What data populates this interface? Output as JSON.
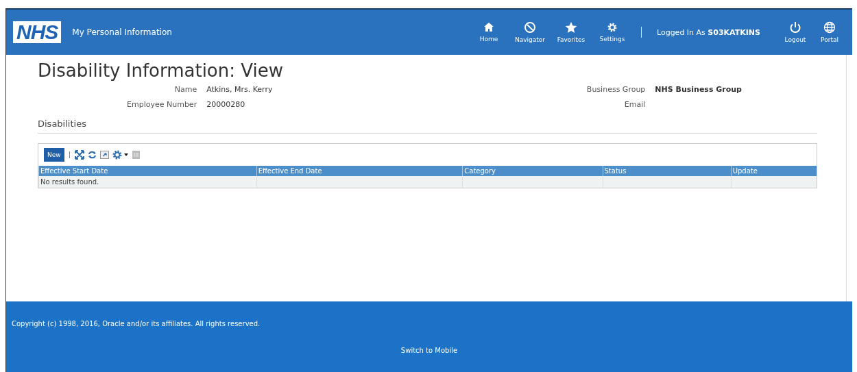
{
  "header": {
    "logo": "NHS",
    "app_title": "My Personal Information",
    "nav": [
      {
        "kind": "home",
        "label": "Home"
      },
      {
        "kind": "navigator",
        "label": "Navigator"
      },
      {
        "kind": "favorites",
        "label": "Favorites"
      },
      {
        "kind": "settings",
        "label": "Settings"
      }
    ],
    "logged_in": "Logged In As **S03KATKINS**",
    "actions": [
      {
        "kind": "logout",
        "label": "Logout"
      },
      {
        "kind": "portal",
        "label": "Portal"
      }
    ]
  },
  "page_title": "Disability Information: View",
  "fields_left": [
    {
      "label": "Name",
      "value": "Atkins, Mrs. Kerry"
    },
    {
      "label": "Employee Number",
      "value": "20000280"
    }
  ],
  "fields_right": [
    {
      "label": "Business Group",
      "value": "NHS Business Group"
    },
    {
      "label": "Email"
    }
  ],
  "section_title": "Disabilities",
  "toolbar": {
    "new_label": "New",
    "tools": [
      {
        "kind": "detach",
        "disabled": false
      },
      {
        "kind": "refresh",
        "disabled": false
      },
      {
        "kind": "export",
        "disabled": false
      },
      {
        "kind": "settings",
        "disabled": false
      },
      {
        "kind": "wrap",
        "disabled": true
      }
    ]
  },
  "table": {
    "columns": [
      "Effective Start Date",
      "Effective End Date",
      "Category",
      "Status",
      "Update"
    ],
    "empty_message": "No results found."
  },
  "footer": {
    "copyright": "Copyright (c) 1998, 2016, Oracle and/or its affiliates. All rights reserved.",
    "switch_link": "Switch to Mobile"
  }
}
